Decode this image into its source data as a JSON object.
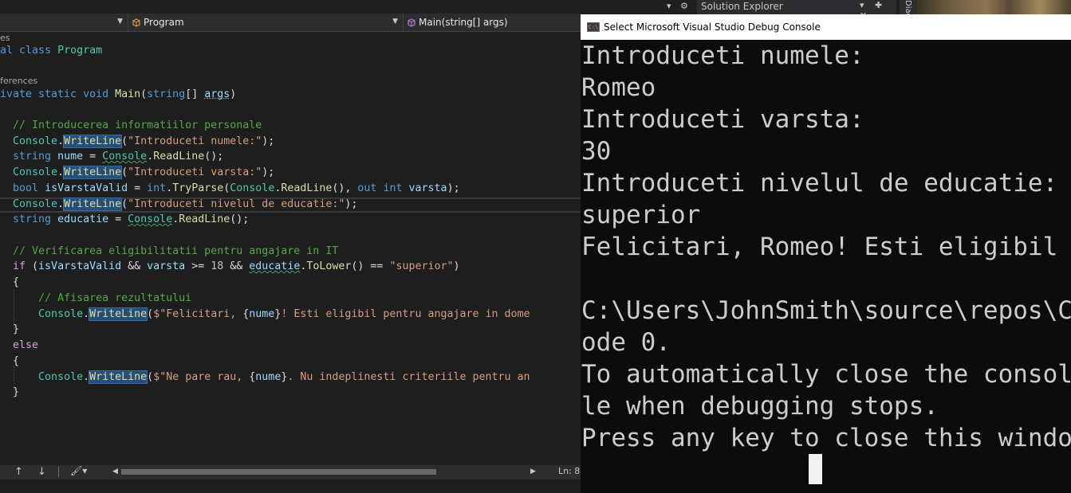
{
  "navbar": {
    "class_dropdown": "Program",
    "member_dropdown": "Main(string[] args)"
  },
  "codelens": {
    "class_refs": "es",
    "method_refs": "ferences"
  },
  "code": {
    "class_decl": {
      "kw": "al class ",
      "name": "Program"
    },
    "method_decl": {
      "kw1": "ivate static void ",
      "name": "Main",
      "p1": "(",
      "type": "string",
      "p2": "[] ",
      "arg": "args",
      "p3": ")"
    },
    "comment1": "// Introducerea informatiilor personale",
    "comment2": "// Verificarea eligibilitatii pentru angajare in IT",
    "comment3": "// Afisarea rezultatului",
    "str_numele": "\"Introduceti numele:\"",
    "str_varsta": "\"Introduceti varsta:\"",
    "str_educatie": "\"Introduceti nivelul de educatie:\"",
    "str_superior": "\"superior\"",
    "str_felicitari_a": "$\"Felicitari, ",
    "str_felicitari_b": "! Esti eligibil pentru angajare in dome",
    "str_ne_pare_a": "$\"Ne pare rau, ",
    "str_ne_pare_b": ". Nu indeplinesti criteriile pentru an",
    "kw_string": "string",
    "kw_bool": "bool",
    "kw_int": "int",
    "kw_out": "out",
    "kw_if": "if",
    "kw_else": "else",
    "t_console": "Console",
    "t_int": "int",
    "m_writeline": "WriteLine",
    "m_readline": "ReadLine",
    "m_tryparse": "TryParse",
    "m_tolower": "ToLower",
    "v_nume": "nume",
    "v_educatie": "educatie",
    "v_isvarstavalid": "isVarstaValid",
    "v_varsta": "varsta",
    "n_18": "18"
  },
  "editor_status": {
    "up_arrow": "↑",
    "down_arrow": "↓",
    "position": "Ln: 8"
  },
  "console": {
    "title": "Select Microsoft Visual Studio Debug Console",
    "lines": [
      "Introduceti numele:",
      "Romeo",
      "Introduceti varsta:",
      "30",
      "Introduceti nivelul de educatie:",
      "superior",
      "Felicitari, Romeo! Esti eligibil",
      "",
      "C:\\Users\\JohnSmith\\source\\repos\\C",
      "ode 0.",
      "To automatically close the consol",
      "le when debugging stops.",
      "Press any key to close this windo"
    ]
  },
  "solution_explorer": {
    "title": "Solution Explorer",
    "diag_tab": "Diag"
  },
  "colors": {
    "editor_bg": "#1e1e1e",
    "console_bg": "#0c0c0c",
    "keyword": "#569cd6",
    "type": "#4ec9b0",
    "method": "#dcdcaa",
    "string": "#d69d85",
    "comment": "#57a64a",
    "variable": "#9cdcfe",
    "control": "#d8a0df",
    "number": "#b5cea8"
  },
  "icons": [
    "class-icon",
    "method-icon",
    "brush-icon",
    "console-app-icon"
  ]
}
